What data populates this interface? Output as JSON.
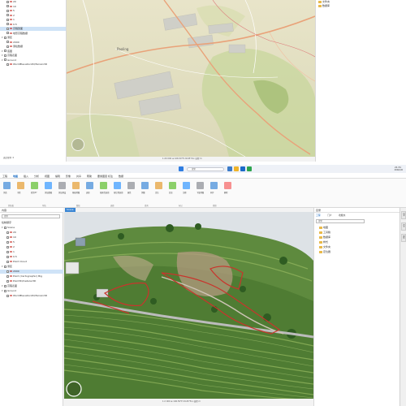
{
  "top": {
    "contents_items": [
      {
        "label": "20",
        "type": "layer"
      },
      {
        "label": "10",
        "type": "layer"
      },
      {
        "label": "5",
        "type": "layer"
      },
      {
        "label": "2",
        "type": "layer"
      },
      {
        "label": "1",
        "type": "layer"
      },
      {
        "label": "0.5",
        "type": "layer"
      },
      {
        "label": "高程剖面",
        "type": "layer",
        "selected": true
      },
      {
        "label": "地形高程数据",
        "type": "layer"
      },
      {
        "label": "测区",
        "type": "group"
      },
      {
        "label": "2000",
        "type": "layer"
      },
      {
        "label": "测绘数据",
        "type": "layer"
      },
      {
        "label": "底图",
        "type": "group"
      },
      {
        "label": "高程表面",
        "type": "group"
      },
      {
        "label": "Ground",
        "type": "group"
      },
      {
        "label": "WorldElevation3D/Terrain3D",
        "type": "layer"
      }
    ],
    "map_place_label": "Paoling",
    "status": "1:20 000  ⊕ 106.59°E 29.65°N  ▾  高程 m",
    "catalog_items": [
      "文件夹",
      "数据库"
    ],
    "bottom_left_status": "选定要素: 0"
  },
  "taskbar": {
    "search_placeholder": "搜索",
    "time": "21:31",
    "date": "2024/1/6"
  },
  "ribbon": {
    "tabs": [
      "工程",
      "地图",
      "插入",
      "分析",
      "视图",
      "编辑",
      "影像",
      "共享",
      "帮助",
      "要素图层",
      "标注",
      "数据"
    ],
    "groups": [
      "剪贴板",
      "导航",
      "图层",
      "选择",
      "查询",
      "标记",
      "离线"
    ],
    "buttons": [
      "浏览",
      "书签",
      "转到XY",
      "添加数据",
      "添加预设",
      "基础地图",
      "选择",
      "按属性选择",
      "按位置选择",
      "属性",
      "测量",
      "定位",
      "信息",
      "注释",
      "下载地图",
      "同步",
      "删除"
    ]
  },
  "bottom": {
    "contents_title": "内容",
    "contents_search": "搜索",
    "contents_heading": "绘制顺序",
    "contents_items": [
      {
        "label": "Scene",
        "type": "group"
      },
      {
        "label": "20",
        "type": "layer"
      },
      {
        "label": "10",
        "type": "layer"
      },
      {
        "label": "5",
        "type": "layer"
      },
      {
        "label": "2",
        "type": "layer"
      },
      {
        "label": "1",
        "type": "layer"
      },
      {
        "label": "0.5",
        "type": "layer"
      },
      {
        "label": "Point Cloud",
        "type": "layer"
      },
      {
        "label": "测区",
        "type": "group"
      },
      {
        "label": "2000",
        "type": "layer",
        "selected": true
      },
      {
        "label": "Point (Cartographic) Big",
        "type": "layer"
      },
      {
        "label": "Point3D/Cellular3D",
        "type": "layer"
      },
      {
        "label": "高程表面",
        "type": "group"
      },
      {
        "label": "Ground",
        "type": "group"
      },
      {
        "label": "WorldElevation3D/Terrain3D",
        "type": "layer"
      }
    ],
    "view_tab": "Scene",
    "status": "1:2 000  ⊕ 106.59°E 29.65°N  ▾  高程 m",
    "catalog_title": "目录",
    "catalog_search": "搜索",
    "catalog_tabs": [
      "工程",
      "门户",
      "收藏夹"
    ],
    "catalog_items": [
      "地图",
      "工具箱",
      "数据库",
      "样式",
      "文件夹",
      "定位器"
    ],
    "side_tabs": [
      "目录",
      "符号",
      "属性"
    ]
  },
  "colors": {
    "accent": "#3a86d4",
    "selection": "#cfe3f7",
    "boundary": "#c9342c"
  },
  "icons": {
    "windows": "windows-logo-icon",
    "search": "search-icon",
    "folder": "folder-icon",
    "compass": "compass-icon"
  }
}
